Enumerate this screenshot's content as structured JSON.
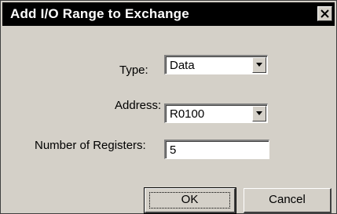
{
  "window": {
    "title": "Add I/O Range to Exchange",
    "close_glyph": "×"
  },
  "form": {
    "type_label": "Type:",
    "type_value": "Data",
    "address_label": "Address:",
    "address_value": "R0100",
    "registers_label": "Number of Registers:",
    "registers_value": "5"
  },
  "buttons": {
    "ok_label": "OK",
    "cancel_label": "Cancel"
  },
  "icons": {
    "close": "close-icon",
    "dropdown": "chevron-down-icon"
  },
  "colors": {
    "titlebar": "#000000",
    "face": "#d4d0c8",
    "field": "#ffffff"
  }
}
